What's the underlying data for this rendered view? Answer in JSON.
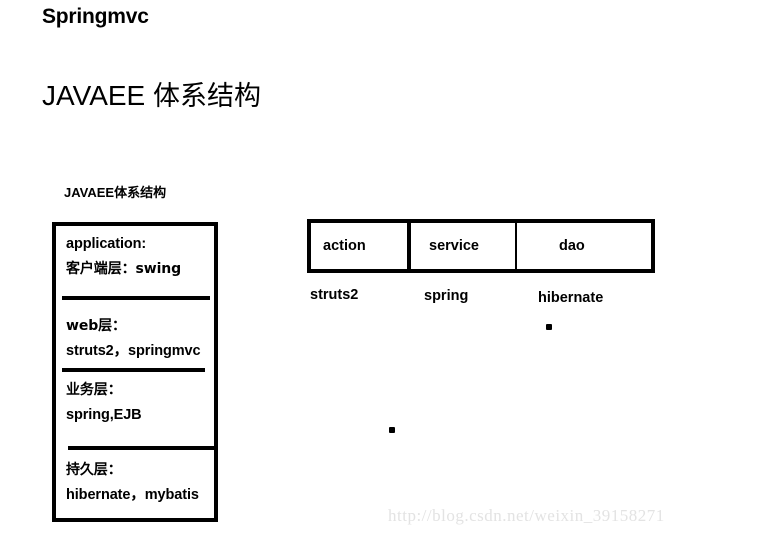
{
  "slide": {
    "title": "Springmvc",
    "subtitle_latin": "JAVAEE ",
    "subtitle_cjk": "体系结构",
    "background_color": "#ffffff",
    "ink_color": "#000000"
  },
  "figure_left": {
    "caption": "JAVAEE体系结构",
    "layers": [
      {
        "name": "application",
        "line1": "application:",
        "line2": "客户端层：swing"
      },
      {
        "name": "web",
        "line1": "web层：",
        "line2": "struts2，springmvc"
      },
      {
        "name": "service",
        "line1": "业务层：",
        "line2": "spring,EJB"
      },
      {
        "name": "persistence",
        "line1": "持久层：",
        "line2": "hibernate，mybatis"
      }
    ]
  },
  "figure_right": {
    "cells": [
      {
        "label": "action",
        "note": "struts2"
      },
      {
        "label": "service",
        "note": "spring"
      },
      {
        "label": "dao",
        "note": "hibernate"
      }
    ]
  },
  "watermark": {
    "text": "http://blog.csdn.net/weixin_39158271",
    "color": "#e3e3e3"
  }
}
